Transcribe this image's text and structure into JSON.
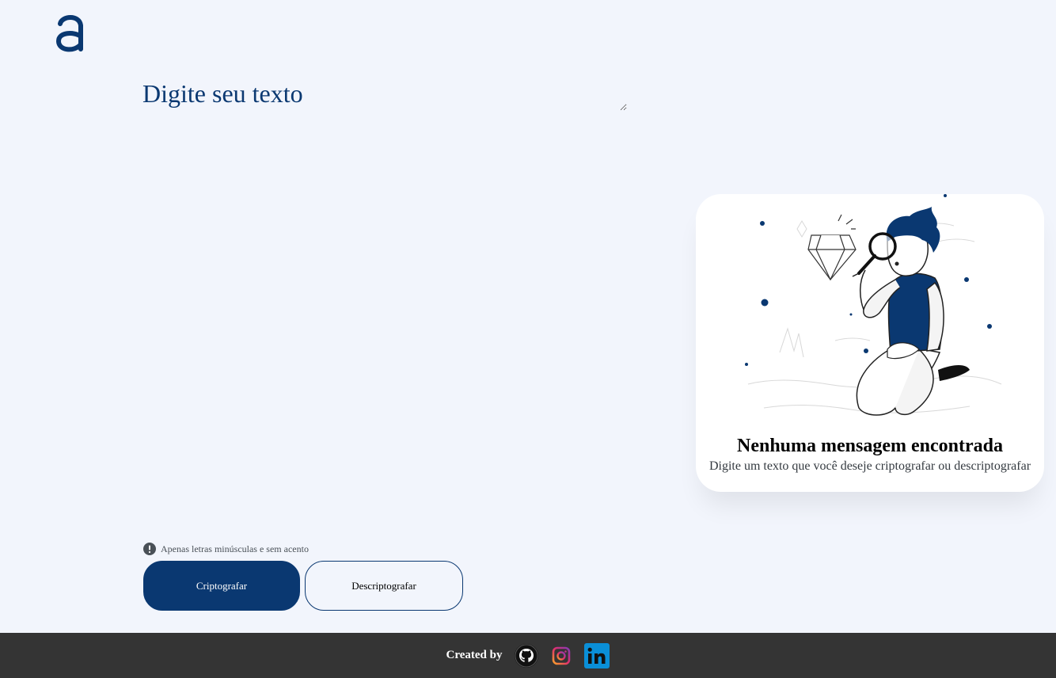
{
  "logo": {
    "icon": "alura-logo-icon",
    "color": "#0a3871"
  },
  "input": {
    "placeholder": "Digite seu texto",
    "value": ""
  },
  "output_panel": {
    "illustration": "person-with-magnifying-glass-icon",
    "title": "Nenhuma mensagem encontrada",
    "subtitle": "Digite um texto que você deseje criptografar ou descriptografar"
  },
  "hint": {
    "icon": "exclamation-circle-icon",
    "text": "Apenas letras minúsculas e sem acento"
  },
  "buttons": {
    "encrypt_label": "Criptografar",
    "decrypt_label": "Descriptografar"
  },
  "footer": {
    "credit": "Created by",
    "links": [
      {
        "icon": "github-icon"
      },
      {
        "icon": "instagram-icon"
      },
      {
        "icon": "linkedin-icon"
      }
    ]
  },
  "colors": {
    "background": "#f2f5fc",
    "primary": "#0a3871",
    "footer": "#343434",
    "panel": "#ffffff"
  }
}
